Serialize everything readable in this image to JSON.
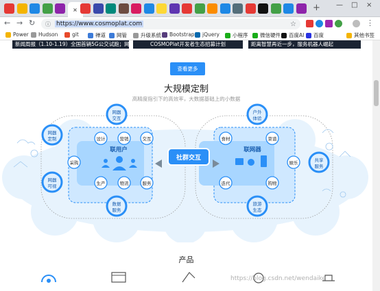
{
  "browser": {
    "url": "https://www.cosmoplat.com",
    "tabs_count": 24,
    "active_tab_close": "×",
    "new_tab": "+",
    "window_controls": [
      "—",
      "□",
      "×"
    ]
  },
  "bookmarks": [
    {
      "label": "Power",
      "color": "#f4b400"
    },
    {
      "label": "Hudson",
      "color": "#999999"
    },
    {
      "label": "git",
      "color": "#e84a2b"
    },
    {
      "label": "禅道",
      "color": "#3c7bd8"
    },
    {
      "label": "网管",
      "color": "#3c7bd8"
    },
    {
      "label": "升级系统",
      "color": "#999999"
    },
    {
      "label": "Bootstrap",
      "color": "#563d7c"
    },
    {
      "label": "jQuery",
      "color": "#0769ad"
    },
    {
      "label": "小程序",
      "color": "#1aad19"
    },
    {
      "label": "微信硬件",
      "color": "#1aad19"
    },
    {
      "label": "百度AI",
      "color": "#111111"
    },
    {
      "label": "百度",
      "color": "#2932e1"
    },
    {
      "label": "其他书签",
      "color": "#f4b400"
    }
  ],
  "news": [
    "新闻周报（1.10-1.19）全国首辆5G公交试跑；网...",
    "COSMOPlat开发者生态招募计划",
    "距离智慧再近一步，服务机器人崛起"
  ],
  "more_button": "查看更多",
  "section": {
    "title": "大规模定制",
    "subtitle": "高精度指引下的高效率，大数据基础上的小数据"
  },
  "diagram": {
    "left_cloud_title": "联用户",
    "right_cloud_title": "联网器",
    "center": "社群交互",
    "outer_nodes": [
      "网器交互",
      "网器定制",
      "网器可视",
      "数据服务",
      "户外体验",
      "共享服务",
      "旅游生态"
    ],
    "left_ring": [
      "设计",
      "营销",
      "交互",
      "采购",
      "生产",
      "物流",
      "服务"
    ],
    "right_ring": [
      "食材",
      "菜谱",
      "娱乐",
      "迭代",
      "购物"
    ],
    "colors": {
      "blue": "#2a8ff7",
      "light": "#dbeeff",
      "stroke": "#4aa5f5"
    }
  },
  "products_title": "产品",
  "watermark": "https://blog.csdn.net/wendaike"
}
